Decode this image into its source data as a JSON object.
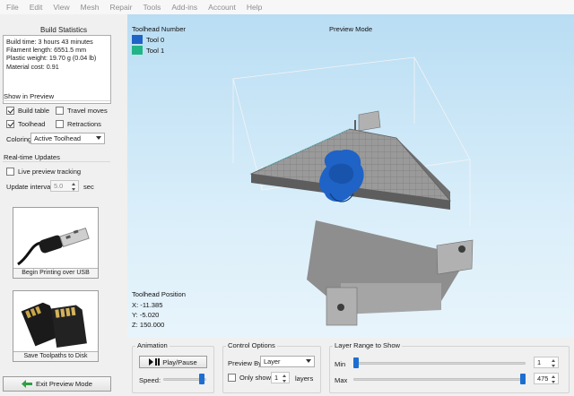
{
  "menubar": [
    "File",
    "Edit",
    "View",
    "Mesh",
    "Repair",
    "Tools",
    "Add-ins",
    "Account",
    "Help"
  ],
  "left": {
    "build_title": "Build Statistics",
    "stats": [
      "Build time: 3 hours 43 minutes",
      "Filament length: 6551.5 mm",
      "Plastic weight: 19.70 g (0.04 lb)",
      "Material cost: 0.91"
    ],
    "show_in_preview": "Show in Preview",
    "build_table": "Build table",
    "travel_moves": "Travel moves",
    "toolhead": "Toolhead",
    "retractions": "Retractions",
    "coloring_label": "Coloring",
    "coloring_value": "Active Toolhead",
    "realtime_title": "Real-time Updates",
    "live_tracking": "Live preview tracking",
    "update_interval_label": "Update interval",
    "update_interval_value": "5.0",
    "update_interval_unit": "sec",
    "usb_caption": "Begin Printing over USB",
    "sd_caption": "Save Toolpaths to Disk",
    "exit_label": "Exit Preview Mode"
  },
  "viewport": {
    "legend_title": "Toolhead Number",
    "mode": "Preview Mode",
    "tool0": "Tool 0",
    "tool1": "Tool 1",
    "tool0_color": "#1f63c6",
    "tool1_color": "#22b487",
    "pos_title": "Toolhead Position",
    "x": "X: -11.385",
    "y": "Y: -5.020",
    "z": "Z: 150.000"
  },
  "animation": {
    "title": "Animation",
    "play_label": "Play/Pause",
    "speed_label": "Speed:",
    "speed_fraction": 0.95
  },
  "control": {
    "title": "Control Options",
    "preview_by_label": "Preview By",
    "preview_by_value": "Layer",
    "only_show_label": "Only show",
    "only_show_value": "1",
    "layers_label": "layers"
  },
  "layer_range": {
    "title": "Layer Range to Show",
    "min_label": "Min",
    "min_value": "1",
    "max_label": "Max",
    "max_value": "475",
    "min_fraction": 0.0,
    "max_fraction": 1.0
  }
}
